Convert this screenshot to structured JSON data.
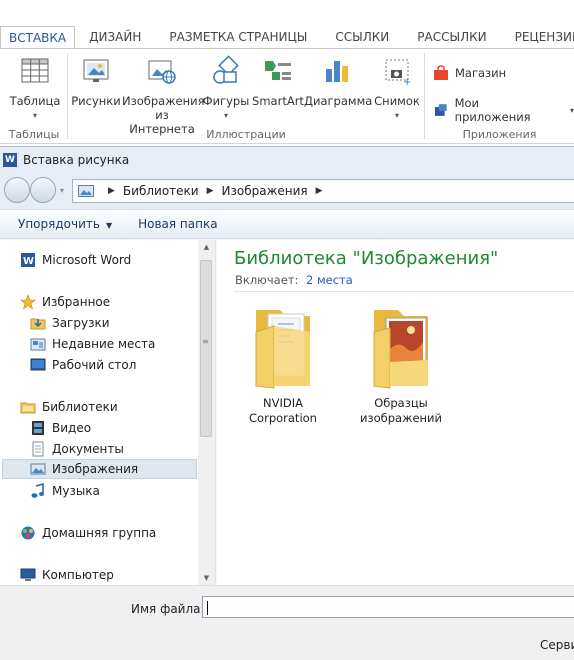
{
  "ribbon": {
    "tabs": [
      {
        "label": "ВСТАВКА",
        "active": true
      },
      {
        "label": "ДИЗАЙН"
      },
      {
        "label": "РАЗМЕТКА СТРАНИЦЫ"
      },
      {
        "label": "ССЫЛКИ"
      },
      {
        "label": "РАССЫЛКИ"
      },
      {
        "label": "РЕЦЕНЗИРОВ"
      }
    ],
    "groups": {
      "tables": {
        "label": "Таблицы",
        "button": "Таблица"
      },
      "illustrations": {
        "label": "Иллюстрации",
        "buttons": {
          "pictures": "Рисунки",
          "online_pictures_1": "Изображения",
          "online_pictures_2": "из Интернета",
          "shapes": "Фигуры",
          "smartart": "SmartArt",
          "chart": "Диаграмма",
          "screenshot": "Снимок"
        }
      },
      "apps": {
        "label": "Приложения",
        "store": "Магазин",
        "my_apps": "Мои приложения"
      }
    },
    "colors": {
      "accent": "#2b579a",
      "store": "#e8452b"
    }
  },
  "dialog": {
    "title": "Вставка рисунка",
    "breadcrumb": [
      "Библиотеки",
      "Изображения"
    ],
    "toolbar": {
      "organize": "Упорядочить",
      "new_folder": "Новая папка"
    },
    "nav": {
      "word": "Microsoft Word",
      "favorites": "Избранное",
      "downloads": "Загрузки",
      "recent": "Недавние места",
      "desktop": "Рабочий стол",
      "libraries": "Библиотеки",
      "video": "Видео",
      "documents": "Документы",
      "pictures": "Изображения",
      "music": "Музыка",
      "homegroup": "Домашняя группа",
      "computer": "Компьютер"
    },
    "content": {
      "title": "Библиотека \"Изображения\"",
      "includes_label": "Включает:",
      "includes_link": "2 места",
      "folders": [
        {
          "line1": "NVIDIA",
          "line2": "Corporation"
        },
        {
          "line1": "Образцы",
          "line2": "изображений"
        }
      ],
      "title_color": "#1e8a2e"
    },
    "filename": {
      "label": "Имя файла:",
      "value": ""
    },
    "service_button": "Серви"
  }
}
